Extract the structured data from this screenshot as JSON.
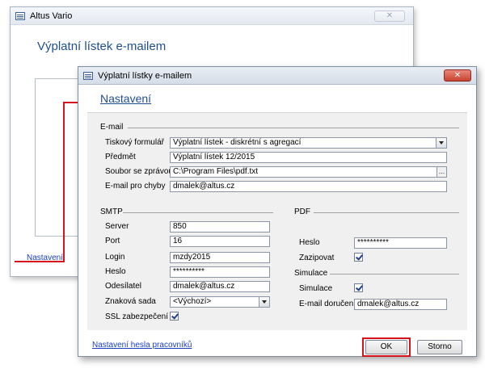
{
  "background_window": {
    "title": "Altus Vario",
    "close_glyph": "✕",
    "heading": "Výplatní lístek e-mailem",
    "settings_link": "Nastavení"
  },
  "dialog": {
    "title": "Výplatní lístky e-mailem",
    "close_glyph": "✕",
    "heading": "Nastavení",
    "email_section": {
      "title": "E-mail",
      "form_label": "Tiskový formulář",
      "form_value": "Výplatní lístek - diskrétní s agregací",
      "subject_label": "Předmět",
      "subject_value": "Výplatní lístek 12/2015",
      "message_file_label": "Soubor se zprávou",
      "message_file_value": "C:\\Program Files\\pdf.txt",
      "browse_glyph": "...",
      "error_email_label": "E-mail pro chyby",
      "error_email_value": "dmalek@altus.cz"
    },
    "smtp_section": {
      "title": "SMTP",
      "server_label": "Server",
      "server_value": "850",
      "port_label": "Port",
      "port_value": "16",
      "login_label": "Login",
      "login_value": "mzdy2015",
      "password_label": "Heslo",
      "password_value": "**********",
      "sender_label": "Odesílatel",
      "sender_value": "dmalek@altus.cz",
      "charset_label": "Znaková sada",
      "charset_value": "<Výchozí>",
      "ssl_label": "SSL zabezpečení",
      "ssl_checked": true
    },
    "pdf_section": {
      "title": "PDF",
      "password_label": "Heslo",
      "password_value": "**********",
      "lock_label": "Zazipovat",
      "lock_checked": true
    },
    "simulation_section": {
      "title": "Simulace",
      "simulation_label": "Simulace",
      "simulation_checked": true,
      "delivery_email_label": "E-mail doručení",
      "delivery_email_value": "dmalek@altus.cz"
    },
    "worker_password_link": "Nastavení hesla pracovníků",
    "ok_label": "OK",
    "cancel_label": "Storno"
  },
  "colors": {
    "highlight": "#d8131b",
    "heading_blue": "#1f4f8e",
    "link_blue": "#1a3ec0"
  }
}
